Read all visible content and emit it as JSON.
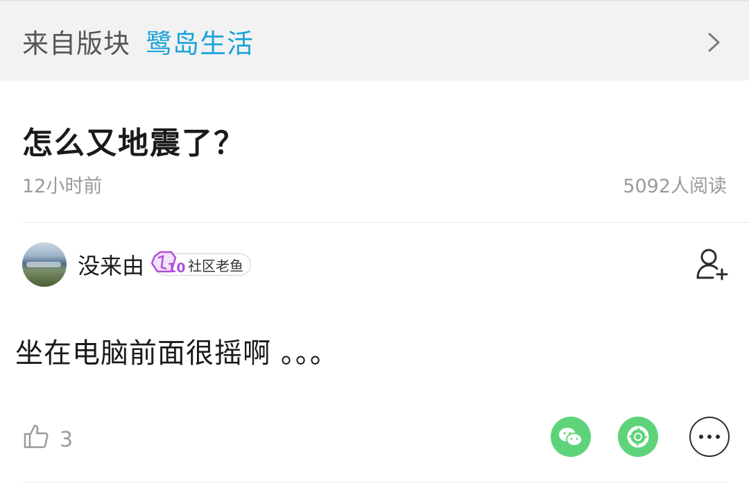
{
  "board": {
    "prefix": "来自版块",
    "name": "鹭岛生活"
  },
  "post": {
    "title": "怎么又地震了？",
    "time": "12小时前",
    "reads": "5092人阅读",
    "body": "坐在电脑前面很摇啊 。。。"
  },
  "author": {
    "name": "没来由",
    "level": "10",
    "badge_label": "社区老鱼"
  },
  "actions": {
    "like_count": "3"
  },
  "icons": {
    "chevron": "chevron-right-icon",
    "follow": "add-user-icon",
    "like": "thumbs-up-icon",
    "wechat": "wechat-icon",
    "moments": "moments-icon",
    "more": "more-icon"
  },
  "colors": {
    "board_link": "#1aa3d9",
    "share_green": "#5ed37a",
    "badge_purple": "#b14fd6"
  }
}
